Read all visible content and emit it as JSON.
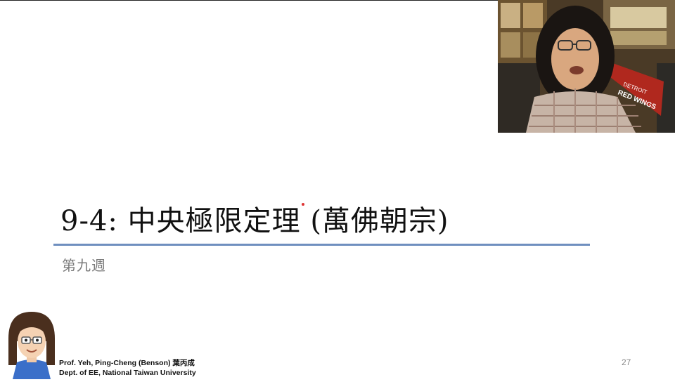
{
  "slide": {
    "title": "9-4: 中央極限定理 (萬佛朝宗)",
    "subtitle": "第九週",
    "page_number": "27"
  },
  "credit": {
    "line1": "Prof. Yeh, Ping-Cheng (Benson) 葉丙成",
    "line2": "Dept. of EE,  National Taiwan University"
  },
  "webcam": {
    "pennant_text": "RED WINGS",
    "pennant_city": "DETROIT"
  },
  "colors": {
    "title_rule": "#6f8fbf",
    "subtitle": "#7a7a7a"
  }
}
